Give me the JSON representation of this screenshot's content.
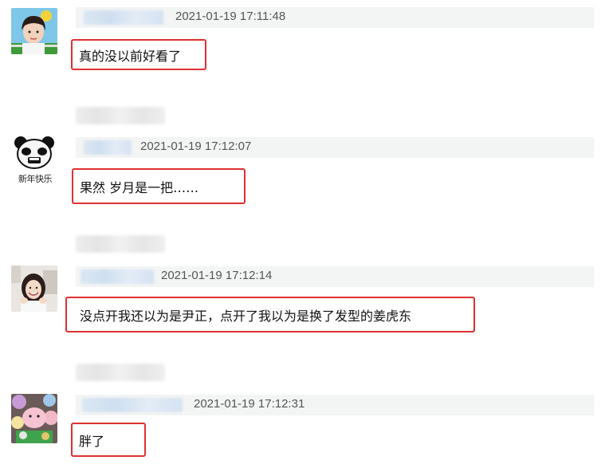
{
  "comments": [
    {
      "timestamp": "2021-01-19 17:11:48",
      "text": "真的没以前好看了",
      "avatar_icon": "girl-sunflower-avatar"
    },
    {
      "timestamp": "2021-01-19 17:12:07",
      "text": "果然 岁月是一把……",
      "avatar_icon": "panda-meme-avatar",
      "avatar_caption": "新年快乐"
    },
    {
      "timestamp": "2021-01-19 17:12:14",
      "text": "没点开我还以为是尹正，点开了我以为是换了发型的姜虎东",
      "avatar_icon": "smiling-girl-avatar"
    },
    {
      "timestamp": "2021-01-19 17:12:31",
      "text": "胖了",
      "avatar_icon": "plush-toys-avatar"
    }
  ],
  "colors": {
    "highlight_border": "#e03030",
    "meta_bar": "#f3f4f4",
    "timestamp": "#555555"
  }
}
